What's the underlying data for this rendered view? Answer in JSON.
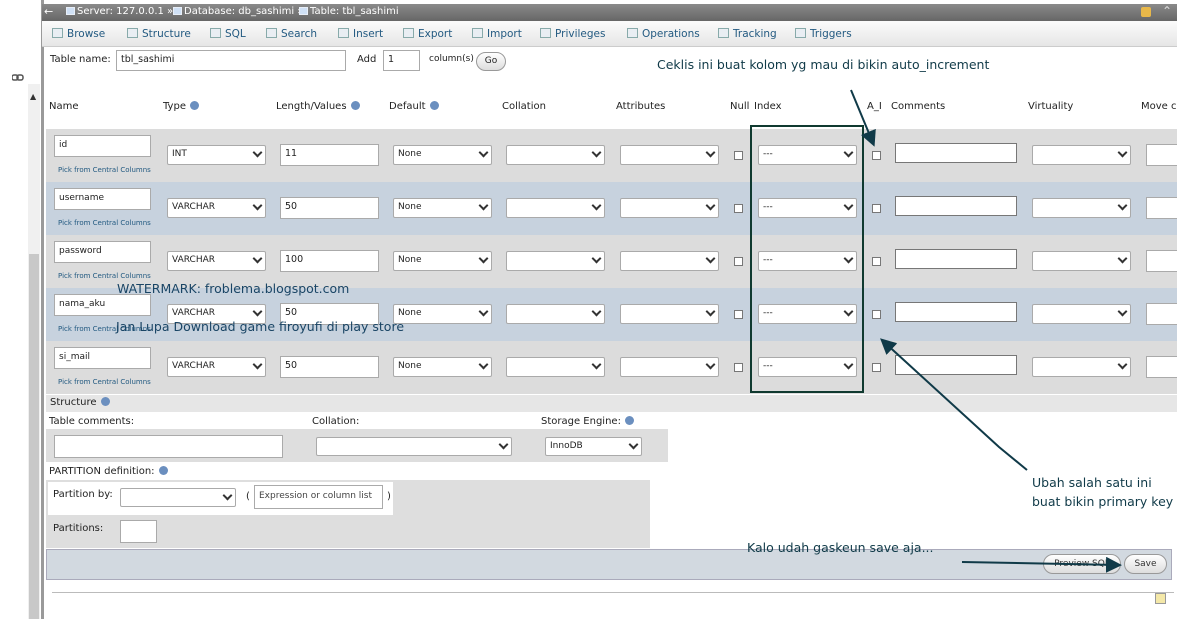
{
  "breadcrumb": {
    "back": "←",
    "server": "Server: 127.0.0.1 »",
    "database": "Database: db_sashimi »",
    "table": "Table: tbl_sashimi"
  },
  "tabs": [
    "Browse",
    "Structure",
    "SQL",
    "Search",
    "Insert",
    "Export",
    "Import",
    "Privileges",
    "Operations",
    "Tracking",
    "Triggers"
  ],
  "table_form": {
    "table_name_label": "Table name:",
    "table_name_value": "tbl_sashimi",
    "add_label": "Add",
    "add_value": "1",
    "columns_label": "column(s)",
    "go_label": "Go"
  },
  "headers": {
    "name": "Name",
    "type": "Type",
    "length": "Length/Values",
    "default": "Default",
    "collation": "Collation",
    "attributes": "Attributes",
    "null": "Null",
    "index": "Index",
    "ai": "A_I",
    "comments": "Comments",
    "virtuality": "Virtuality",
    "move": "Move c"
  },
  "pick_label": "Pick from Central Columns",
  "rows": [
    {
      "name": "id",
      "type": "INT",
      "length": "11",
      "default": "None",
      "index": "---"
    },
    {
      "name": "username",
      "type": "VARCHAR",
      "length": "50",
      "default": "None",
      "index": "---"
    },
    {
      "name": "password",
      "type": "VARCHAR",
      "length": "100",
      "default": "None",
      "index": "---"
    },
    {
      "name": "nama_aku",
      "type": "VARCHAR",
      "length": "50",
      "default": "None",
      "index": "---"
    },
    {
      "name": "si_mail",
      "type": "VARCHAR",
      "length": "50",
      "default": "None",
      "index": "---"
    }
  ],
  "structure": {
    "title": "Structure",
    "table_comments_label": "Table comments:",
    "collation_label": "Collation:",
    "storage_engine_label": "Storage Engine:",
    "storage_engine_value": "InnoDB",
    "partition_def_label": "PARTITION definition:",
    "partition_by_label": "Partition by:",
    "expression_placeholder": "Expression or column list",
    "paren_open": "(",
    "paren_close": ")",
    "partitions_label": "Partitions:"
  },
  "footer": {
    "preview_sql": "Preview SQL",
    "save": "Save"
  },
  "annotations": {
    "ai_note": "Ceklis ini buat kolom yg mau di bikin auto_increment",
    "index_note_line1": "Ubah salah satu ini",
    "index_note_line2": "buat bikin primary key",
    "save_note": "Kalo udah gaskeun save aja...",
    "watermark_line1": "WATERMARK: froblema.blogspot.com",
    "watermark_line2": "Jan Lupa Download game firoyufi di play store"
  },
  "colors": {
    "annotation": "#103a48",
    "row_odd": "#dcdcdc",
    "row_even": "#c7d2de",
    "link": "#235a81"
  }
}
